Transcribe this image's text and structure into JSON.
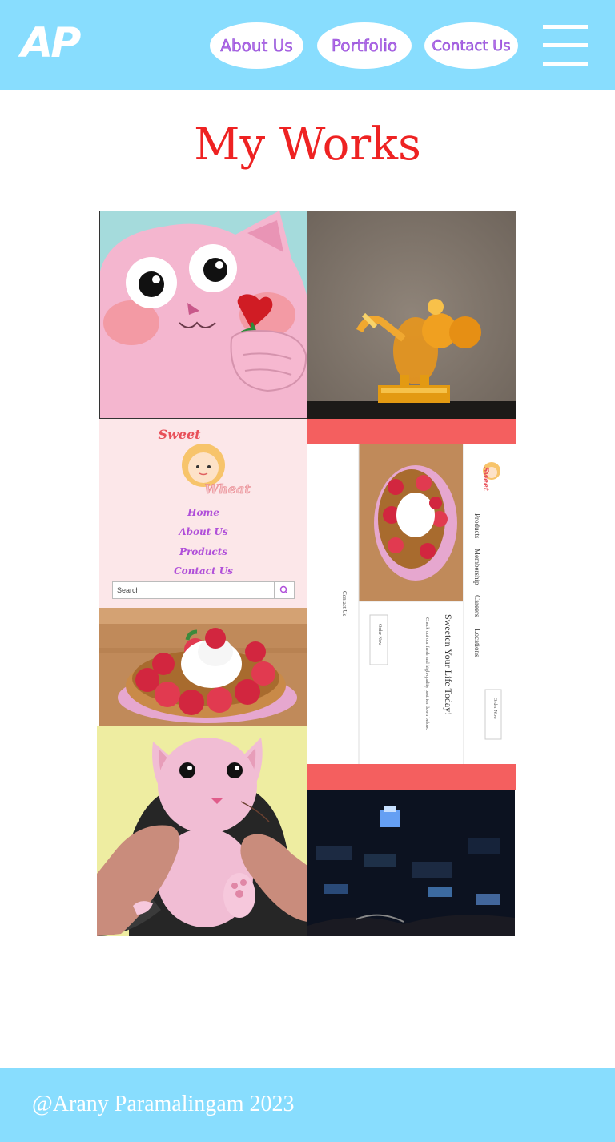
{
  "header": {
    "logo": "AP",
    "nav": {
      "about": "About Us",
      "portfolio": "Portfolio",
      "contact": "Contact Us"
    },
    "menu_icon": "hamburger-menu-icon"
  },
  "page_title": "My Works",
  "works": {
    "sweet_wheat": {
      "brand_top": "Sweet",
      "brand_bottom": "Wheat",
      "menu": [
        "Home",
        "About Us",
        "Products",
        "Contact Us"
      ],
      "search_placeholder": "Search",
      "search_icon": "magnifier-icon"
    },
    "website_mockup": {
      "brand": "Sweet",
      "nav": [
        "Products",
        "Membership",
        "Careers",
        "Locations"
      ],
      "order_now": "Order Now",
      "headline": "Sweeten Your Life Today!",
      "tagline": "Check out our fresh and high-quality pastries down below.",
      "contact": "Contact Us"
    }
  },
  "footer": {
    "text": "@Arany Paramalingam 2023"
  },
  "colors": {
    "header_bg": "#88ddfe",
    "title": "#ee2222",
    "nav_text": "#b86ae8",
    "accent_red": "#f45f5f"
  }
}
